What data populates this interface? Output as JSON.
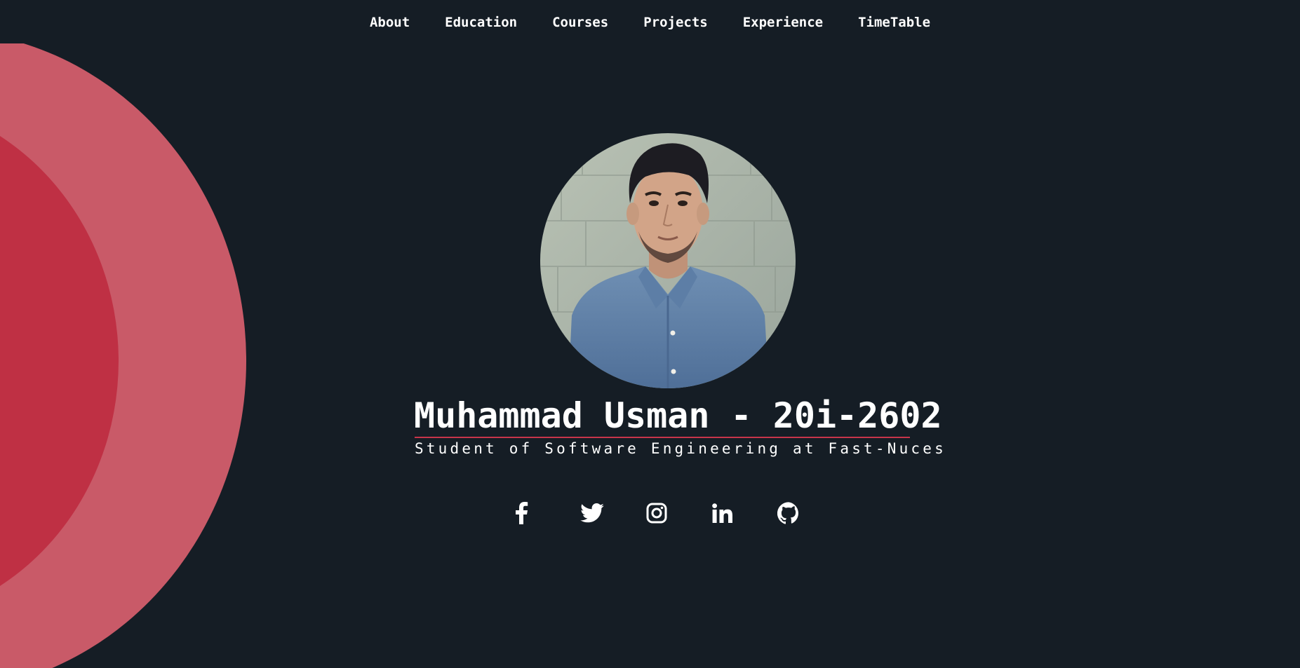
{
  "nav": {
    "items": [
      {
        "label": "About"
      },
      {
        "label": "Education"
      },
      {
        "label": "Courses"
      },
      {
        "label": "Projects"
      },
      {
        "label": "Experience"
      },
      {
        "label": "TimeTable"
      }
    ]
  },
  "hero": {
    "name": "Muhammad Usman - 20i-2602",
    "tagline": "Student of Software Engineering at Fast-Nuces",
    "photo_alt": "profile photo"
  },
  "socials": [
    {
      "icon": "facebook-icon"
    },
    {
      "icon": "twitter-icon"
    },
    {
      "icon": "instagram-icon"
    },
    {
      "icon": "linkedin-icon"
    },
    {
      "icon": "github-icon"
    }
  ],
  "colors": {
    "background": "#151d25",
    "accent": "#c7354a",
    "arc_outer": "#c95a68",
    "arc_inner": "#bf3044",
    "text": "#ffffff"
  }
}
